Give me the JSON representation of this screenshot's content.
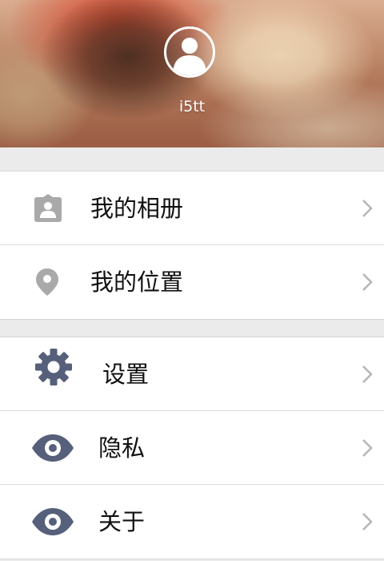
{
  "profile": {
    "username": "i5tt"
  },
  "menu_group_1": [
    {
      "label": "我的相册",
      "icon": "photo-album-icon"
    },
    {
      "label": "我的位置",
      "icon": "location-pin-icon"
    }
  ],
  "menu_group_2": [
    {
      "label": "设置",
      "icon": "gear-icon"
    },
    {
      "label": "隐私",
      "icon": "eye-icon"
    },
    {
      "label": "关于",
      "icon": "eye-icon"
    }
  ],
  "colors": {
    "icon_gray": "#a9a9a9",
    "icon_slate": "#56607a",
    "chevron": "#b5b5b5",
    "separator": "#ebebeb"
  }
}
